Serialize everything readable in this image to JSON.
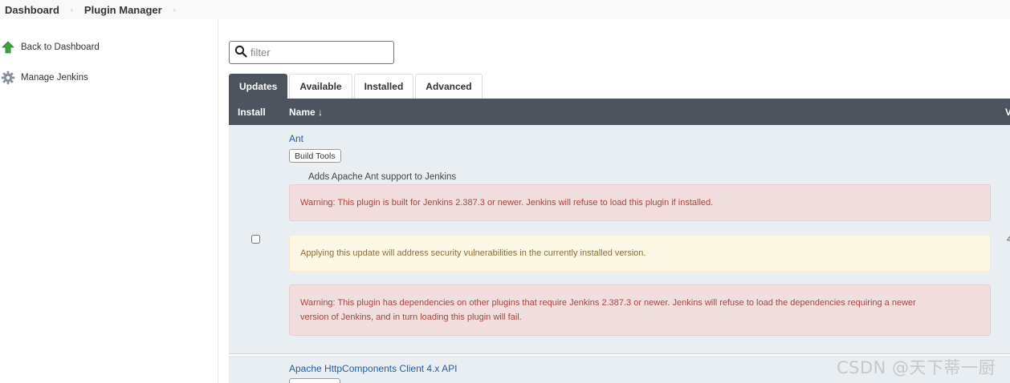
{
  "breadcrumb": {
    "items": [
      "Dashboard",
      "Plugin Manager"
    ],
    "separator": "›"
  },
  "sidebar": {
    "items": [
      {
        "label": "Back to Dashboard",
        "icon": "green-up-arrow-icon"
      },
      {
        "label": "Manage Jenkins",
        "icon": "gear-icon"
      }
    ]
  },
  "search": {
    "placeholder": "filter",
    "value": ""
  },
  "tabs": [
    "Updates",
    "Available",
    "Installed",
    "Advanced"
  ],
  "table": {
    "columns": {
      "install": "Install",
      "name": "Name ↓",
      "version_partial": "V"
    },
    "rows": [
      {
        "name": "Ant",
        "tag": "Build Tools",
        "description": "Adds Apache Ant support to Jenkins",
        "warning_core": "Warning: This plugin is built for Jenkins 2.387.3 or newer. Jenkins will refuse to load this plugin if installed.",
        "security_notice": "Applying this update will address security vulnerabilities in the currently installed version.",
        "warning_deps_line1": "Warning: This plugin has dependencies on other plugins that require Jenkins 2.387.3 or newer. Jenkins will refuse to load the dependencies requiring a newer",
        "warning_deps_line2": "version of Jenkins, and in turn loading this plugin will fail.",
        "version_partial": "4",
        "checked": false
      },
      {
        "name": "Apache HttpComponents Client 4.x API"
      }
    ]
  },
  "watermark": "CSDN @天下蒂一厨",
  "colors": {
    "header_bg": "#4d545d",
    "row_bg": "#e9eef2",
    "link": "#1f5ea8",
    "danger_bg": "#f2dede",
    "warning_bg": "#fcf8e3"
  }
}
